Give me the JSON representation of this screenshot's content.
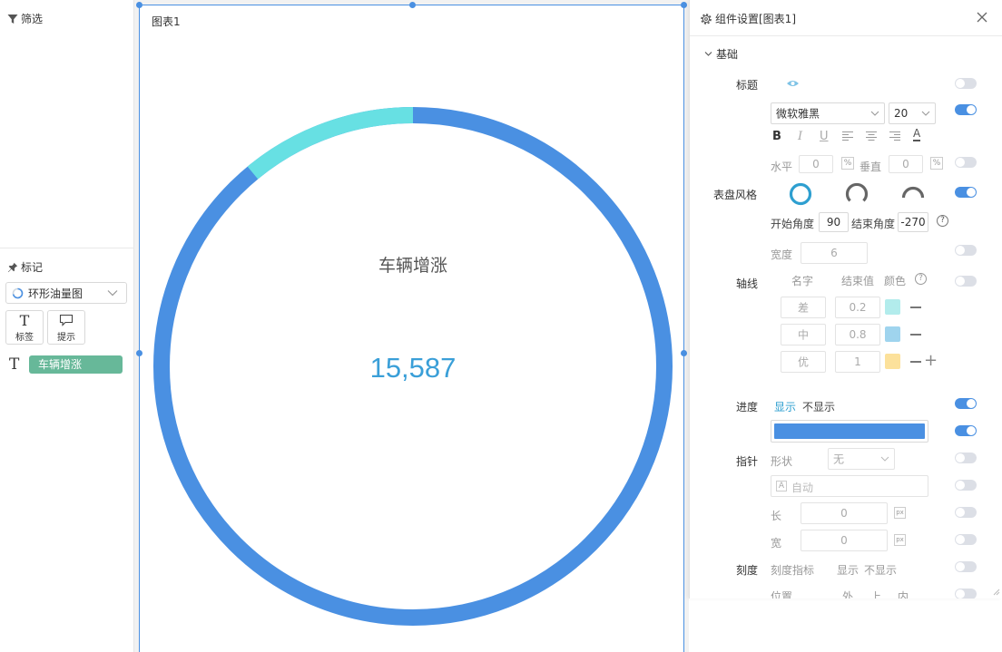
{
  "left_panel": {
    "filter_title": "筛选",
    "mark_title": "标记",
    "chart_type": "环形油量图",
    "mark_buttons": [
      {
        "label": "标签",
        "icon": "T"
      },
      {
        "label": "提示",
        "icon": "speech-bubble-icon"
      }
    ],
    "field_icon": "T",
    "field_name": "车辆增涨"
  },
  "chart": {
    "card_title": "图表1",
    "metric_label": "车辆增涨",
    "value_display": "15,587",
    "track_color": "#4a90e2",
    "progress_color": "#67e0e3",
    "value_color": "#3a9fd8",
    "start_angle": 90,
    "end_angle": -270,
    "progress_fraction": 0.11
  },
  "settings": {
    "header_title": "组件设置[图表1]",
    "section_basic": "基础",
    "title_row": {
      "label": "标题"
    },
    "font": {
      "family_value": "微软雅黑",
      "size_value": "20"
    },
    "format_glyphs": {
      "bold": "B",
      "italic": "I",
      "underline": "U",
      "color": "A"
    },
    "align": {
      "h_label": "水平",
      "h_value": "0",
      "pct": "%",
      "v_label": "垂直",
      "v_value": "0"
    },
    "dial_style": {
      "label": "表盘风格",
      "start_label": "开始角度",
      "start_value": "90",
      "end_label": "结束角度",
      "end_value": "-270",
      "help": "?"
    },
    "width_row": {
      "label": "宽度",
      "value": "6"
    },
    "axis": {
      "label": "轴线",
      "col_name": "名字",
      "col_end": "结束值",
      "col_color": "颜色",
      "help": "?",
      "rows": [
        {
          "name": "差",
          "end": "0.2",
          "color": "#b2ecec"
        },
        {
          "name": "中",
          "end": "0.8",
          "color": "#9fd4ee"
        },
        {
          "name": "优",
          "end": "1",
          "color": "#fce19b"
        }
      ],
      "add": "+"
    },
    "progress": {
      "label": "进度",
      "show": "显示",
      "hide": "不显示",
      "bar_color": "#4a90e2"
    },
    "pointer": {
      "label": "指针",
      "shape_label": "形状",
      "shape_value": "无",
      "auto_icon": "A",
      "auto_placeholder": "自动",
      "length_label": "长",
      "length_value": "0",
      "width_label": "宽",
      "width_value": "0",
      "unit": "px"
    },
    "scale": {
      "label": "刻度",
      "indicator": "刻度指标",
      "show": "显示",
      "hide": "不显示"
    },
    "position": {
      "label": "位置",
      "outer": "外",
      "top": "上",
      "inner": "内"
    }
  }
}
